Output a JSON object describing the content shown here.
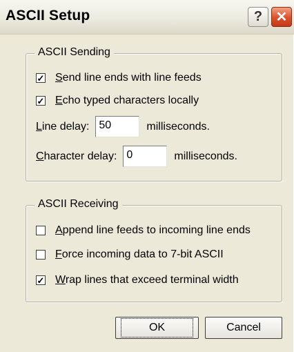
{
  "window": {
    "title": "ASCII Setup",
    "help_glyph": "?",
    "close_glyph": "✕"
  },
  "sending": {
    "group_label": "ASCII Sending",
    "send_line_ends": {
      "mnemonic": "S",
      "rest": "end line ends with line feeds",
      "checked": true
    },
    "echo_typed": {
      "mnemonic": "E",
      "rest": "cho typed characters locally",
      "checked": true
    },
    "line_delay": {
      "mnemonic": "L",
      "rest": "ine delay:",
      "value": "50",
      "units": "milliseconds."
    },
    "character_delay": {
      "mnemonic": "C",
      "rest": "haracter delay:",
      "value": "0",
      "units": "milliseconds."
    }
  },
  "receiving": {
    "group_label": "ASCII Receiving",
    "append_line_feeds": {
      "mnemonic": "A",
      "rest": "ppend line feeds to incoming line ends",
      "checked": false
    },
    "force_7bit": {
      "mnemonic": "F",
      "rest": "orce incoming data to 7-bit ASCII",
      "checked": false
    },
    "wrap_lines": {
      "mnemonic": "W",
      "rest": "rap lines that exceed terminal width",
      "checked": true
    }
  },
  "buttons": {
    "ok": "OK",
    "cancel": "Cancel"
  }
}
